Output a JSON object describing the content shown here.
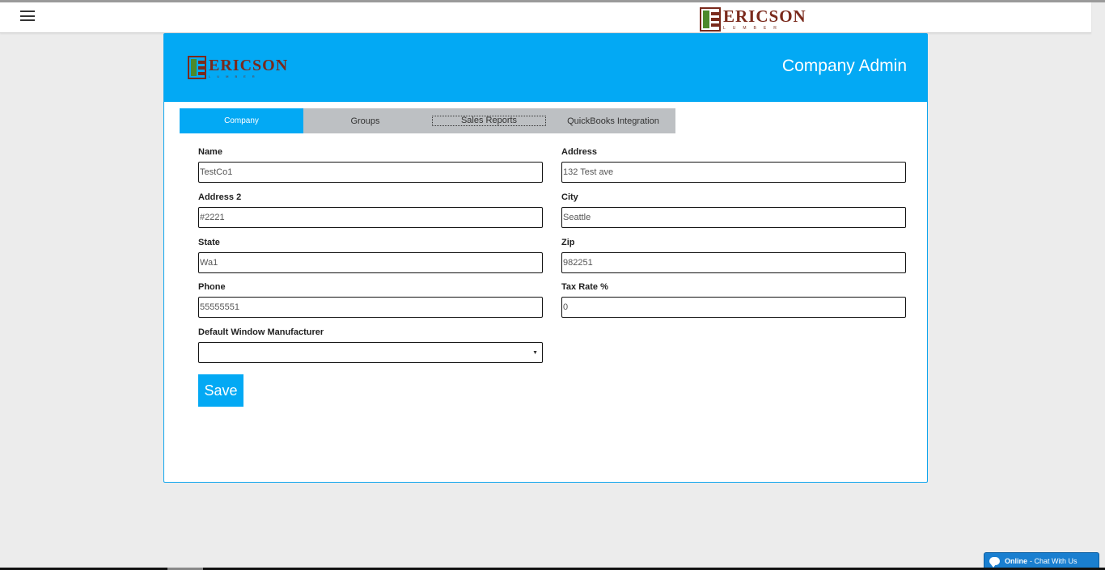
{
  "colors": {
    "accent": "#03a9f4",
    "brand": "#7a2a1c",
    "brand_green": "#4c8a2b"
  },
  "topbar": {
    "menu_icon": "hamburger-menu-icon",
    "brand": "ERICSON",
    "brand_sub": "LUMBER"
  },
  "header": {
    "brand": "ERICSON",
    "brand_sub": "LUMBER",
    "title": "Company Admin"
  },
  "tabs": [
    {
      "label": "Company",
      "active": true
    },
    {
      "label": "Groups",
      "active": false
    },
    {
      "label": "Sales Reports",
      "active": false
    },
    {
      "label": "QuickBooks Integration",
      "active": false
    }
  ],
  "form": {
    "name": {
      "label": "Name",
      "value": "TestCo1"
    },
    "address": {
      "label": "Address",
      "value": "132 Test ave"
    },
    "address2": {
      "label": "Address 2",
      "value": "#2221"
    },
    "city": {
      "label": "City",
      "value": "Seattle"
    },
    "state": {
      "label": "State",
      "value": "Wa1"
    },
    "zip": {
      "label": "Zip",
      "value": "982251"
    },
    "phone": {
      "label": "Phone",
      "value": "55555551"
    },
    "tax_rate": {
      "label": "Tax Rate %",
      "value": "0"
    },
    "window_manufacturer": {
      "label": "Default Window Manufacturer",
      "value": ""
    },
    "save_label": "Save"
  },
  "chat": {
    "status": "Online",
    "label": "- Chat With Us",
    "icon": "chat-bubble-icon"
  }
}
